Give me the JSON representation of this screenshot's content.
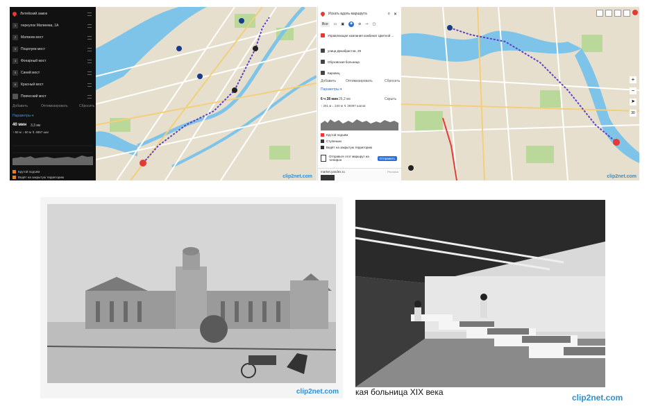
{
  "left_route_panel": {
    "items": [
      {
        "label": "Литейский замок",
        "num": ""
      },
      {
        "label": "переулок Матвеева, 1А",
        "num": "1"
      },
      {
        "label": "Матвеев мост",
        "num": "2"
      },
      {
        "label": "Поцелуев мост",
        "num": "3"
      },
      {
        "label": "Фонарный мост",
        "num": "4"
      },
      {
        "label": "Синий мост",
        "num": "5"
      },
      {
        "label": "Красный мост",
        "num": "6"
      },
      {
        "label": "Певческий мост",
        "num": ""
      }
    ],
    "add_label": "Добавить",
    "optimize_label": "Оптимизировать",
    "reset_label": "Сбросить",
    "params_label": "Параметры ▾",
    "time": "40 мин",
    "distance": "3,3 км",
    "stats": "↑ 60 м   ↓ 60 м   ↯ 4857 шаг",
    "warn1": "Крутой подъём",
    "warn2": "Ведёт на закрытую территорию"
  },
  "right_route_panel": {
    "search_placeholder": "Искать вдоль маршрута",
    "mode_all": "Все",
    "stops": [
      {
        "label": "Управляющая компания комбинат Цветной ..."
      },
      {
        "label": "улица Декабристов, 29"
      },
      {
        "label": "Обуховская больница"
      },
      {
        "label": "Кировец"
      }
    ],
    "add_label": "Добавить",
    "optimize_label": "Оптимизировать",
    "reset_label": "Сбросить",
    "params_label": "Параметры ▾",
    "time": "6 ч 28 мин",
    "distance": "26,2 км",
    "hide_label": "Скрыть",
    "stats": "↑ 251 м   ↓ 240 м   ↯ 39397 шагов",
    "warn1": "Крутой подъём",
    "warn2": "Ступеньки",
    "warn3": "Ведёт на закрытую территорию",
    "send_text": "Отправьте этот маршрут на телефон",
    "send_button": "Отправить",
    "ad_domain": "market.yandex.ru",
    "ad_label": "Реклама"
  },
  "map_zoom_level": "30",
  "watermarks": {
    "wm1": "clip2net.com",
    "wm2": "clip2net.com",
    "wm3": "clip2net.com",
    "wm4": "clip2net.com"
  },
  "caption": "кая больница XIX века"
}
